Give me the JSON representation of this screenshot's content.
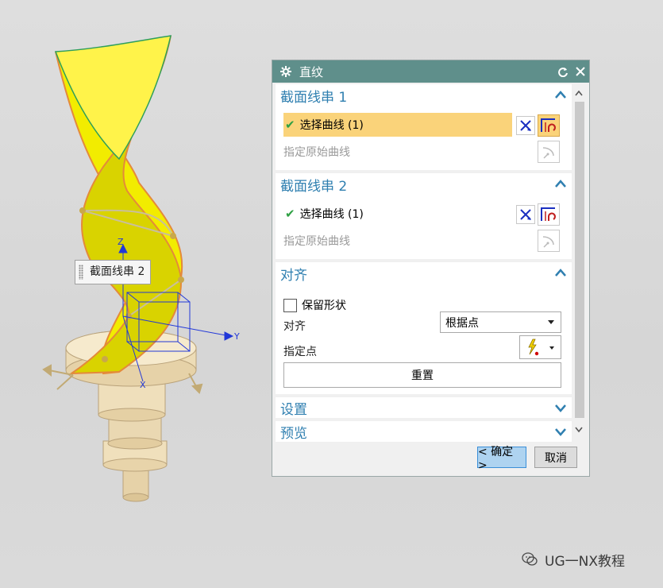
{
  "viewport": {
    "tag_label": "截面线串 2",
    "axis_labels": {
      "z": "Z",
      "y": "Y",
      "x": "X"
    }
  },
  "dialog": {
    "title": "直纹",
    "groups": [
      {
        "header": "截面线串 1",
        "rows": [
          {
            "label": "选择曲线 (1)",
            "checked": true,
            "selected": true
          },
          {
            "label": "指定原始曲线",
            "disabled": true
          }
        ]
      },
      {
        "header": "截面线串 2",
        "rows": [
          {
            "label": "选择曲线 (1)",
            "checked": true,
            "selected": false
          },
          {
            "label": "指定原始曲线",
            "disabled": true
          }
        ]
      },
      {
        "header": "对齐",
        "preserve_shape_label": "保留形状",
        "preserve_shape_checked": false,
        "alignment_label": "对齐",
        "alignment_value": "根据点",
        "specify_point_label": "指定点",
        "reset_label": "重置"
      },
      {
        "header": "设置"
      },
      {
        "header": "预览"
      }
    ],
    "ok_label": "< 确定 >",
    "cancel_label": "取消"
  },
  "watermark": {
    "text": "UG一NX教程"
  },
  "colors": {
    "title_bar": "#5f8f8b",
    "group_header": "#2f7fb0",
    "selected_row": "#fad37a",
    "ok_button": "#aed3f0",
    "surface_yellow": "#f2ec00"
  }
}
